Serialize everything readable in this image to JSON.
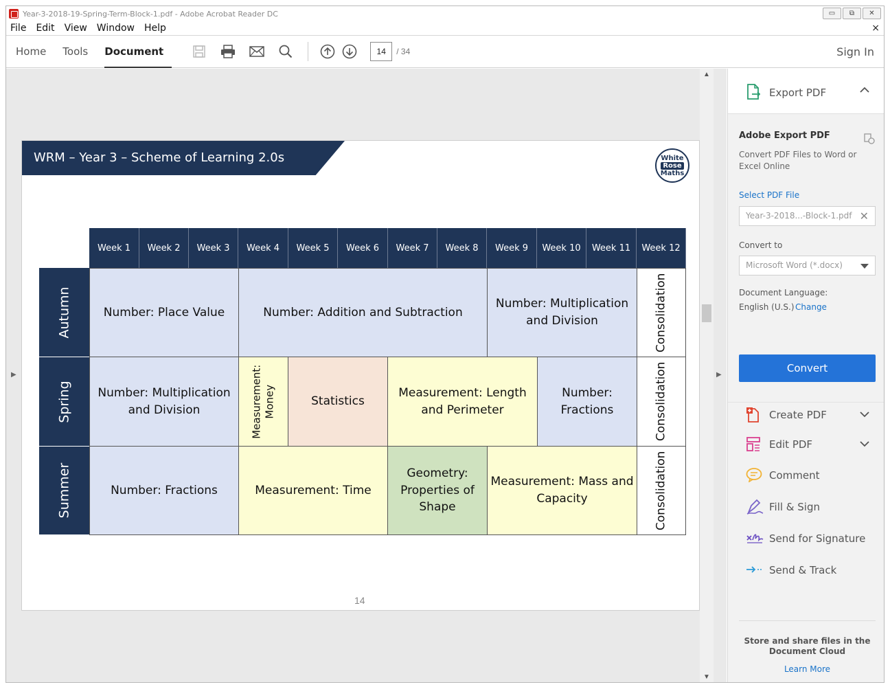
{
  "window": {
    "title": "Year-3-2018-19-Spring-Term-Block-1.pdf - Adobe Acrobat Reader DC",
    "buttons": {
      "minimize": "▭",
      "restore": "⧉",
      "close": "✕"
    }
  },
  "menubar": {
    "items": [
      "File",
      "Edit",
      "View",
      "Window",
      "Help"
    ],
    "close_doc": "×"
  },
  "toolbar": {
    "tabs": [
      {
        "label": "Home"
      },
      {
        "label": "Tools"
      },
      {
        "label": "Document",
        "active": true
      }
    ],
    "page_current": "14",
    "page_total": "/ 34",
    "sign_in": "Sign In"
  },
  "document": {
    "banner_title": "WRM – Year 3 – Scheme of Learning 2.0s",
    "logo": [
      "White",
      "Rose",
      "Maths"
    ],
    "page_number": "14",
    "weeks": [
      "Week 1",
      "Week 2",
      "Week 3",
      "Week 4",
      "Week 5",
      "Week 6",
      "Week 7",
      "Week 8",
      "Week 9",
      "Week 10",
      "Week 11",
      "Week 12"
    ],
    "terms": [
      "Autumn",
      "Spring",
      "Summer"
    ],
    "autumn": {
      "place_value": "Number: Place Value",
      "add_sub": "Number: Addition and Subtraction",
      "mult_div": "Number: Multiplication and Division",
      "consolidation": "Consolidation"
    },
    "spring": {
      "mult_div": "Number: Multiplication and Division",
      "money_line1": "Measurement:",
      "money_line2": "Money",
      "statistics": "Statistics",
      "length": "Measurement: Length and Perimeter",
      "fractions": "Number: Fractions",
      "consolidation": "Consolidation"
    },
    "summer": {
      "fractions": "Number: Fractions",
      "time": "Measurement: Time",
      "geometry": "Geometry: Properties of Shape",
      "mass": "Measurement: Mass and Capacity",
      "consolidation": "Consolidation"
    }
  },
  "right_panel": {
    "export_header": "Export PDF",
    "title": "Adobe Export PDF",
    "description": "Convert PDF Files to Word or Excel Online",
    "select_label": "Select PDF File",
    "selected_file": "Year-3-2018...-Block-1.pdf",
    "convert_to_label": "Convert to",
    "convert_to_value": "Microsoft Word (*.docx)",
    "doc_language_label": "Document Language:",
    "doc_language_value": "English (U.S.)",
    "change_link": "Change",
    "convert_button": "Convert",
    "tools": [
      {
        "label": "Create PDF",
        "icon": "create-pdf-icon",
        "color": "#e0442f"
      },
      {
        "label": "Edit PDF",
        "icon": "edit-pdf-icon",
        "color": "#d9408f"
      },
      {
        "label": "Comment",
        "icon": "comment-icon",
        "color": "#f2b233"
      },
      {
        "label": "Fill & Sign",
        "icon": "fill-sign-icon",
        "color": "#7a64c9"
      },
      {
        "label": "Send for Signature",
        "icon": "send-signature-icon",
        "color": "#6b4fc2"
      },
      {
        "label": "Send & Track",
        "icon": "send-track-icon",
        "color": "#2b9ad6"
      }
    ],
    "footer_text": "Store and share files in the Document Cloud",
    "learn_more": "Learn More"
  },
  "colors": {
    "navy": "#1f3557",
    "cell_blue": "#dbe2f3",
    "cell_yellow": "#fdfdd3",
    "cell_peach": "#f7e4d7",
    "cell_green": "#cfe2bf",
    "accent_button": "#2473d8",
    "link": "#1a73c9"
  }
}
